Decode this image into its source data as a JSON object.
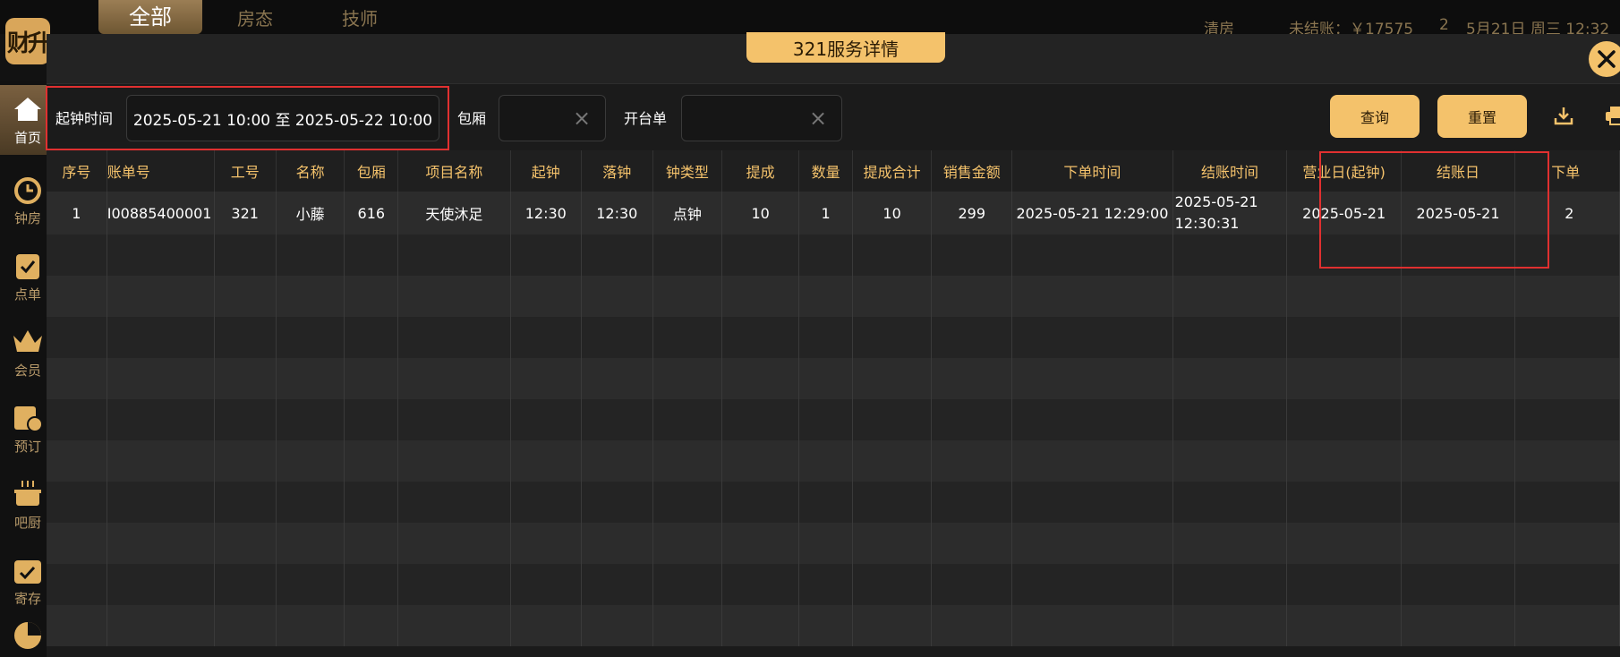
{
  "app": {
    "logo_text": "财升",
    "tabs": [
      "全部",
      "房态",
      "技师"
    ],
    "status": {
      "clean": "清房",
      "unsettled": "未结账：￥17575",
      "count": "2",
      "datetime": "5月21日 周三 12:32"
    },
    "sidebar": [
      "首页",
      "钟房",
      "点单",
      "会员",
      "预订",
      "吧厨",
      "寄存"
    ]
  },
  "modal": {
    "title": "321服务详情",
    "filters": {
      "time_label": "起钟时间",
      "time_value": "2025-05-21 10:00 至 2025-05-22 10:00",
      "room_label": "包厢",
      "room_value": "",
      "order_label": "开台单",
      "order_value": "",
      "query_label": "查询",
      "reset_label": "重置"
    },
    "table": {
      "headers": [
        "序号",
        "账单号",
        "工号",
        "名称",
        "包厢",
        "项目名称",
        "起钟",
        "落钟",
        "钟类型",
        "提成",
        "数量",
        "提成合计",
        "销售金额",
        "下单时间",
        "结账时间",
        "营业日(起钟)",
        "结账日",
        "下单"
      ],
      "rows": [
        [
          "1",
          "I00885400001",
          "321",
          "小藤",
          "616",
          "天使沐足",
          "12:30",
          "12:30",
          "点钟",
          "10",
          "1",
          "10",
          "299",
          "2025-05-21 12:29:00",
          "2025-05-21 12:30:31",
          "2025-05-21",
          "2025-05-21",
          "2"
        ]
      ]
    }
  },
  "colors": {
    "accent": "#f4c26b",
    "highlight": "#e03030",
    "background": "#1b1b1b"
  }
}
